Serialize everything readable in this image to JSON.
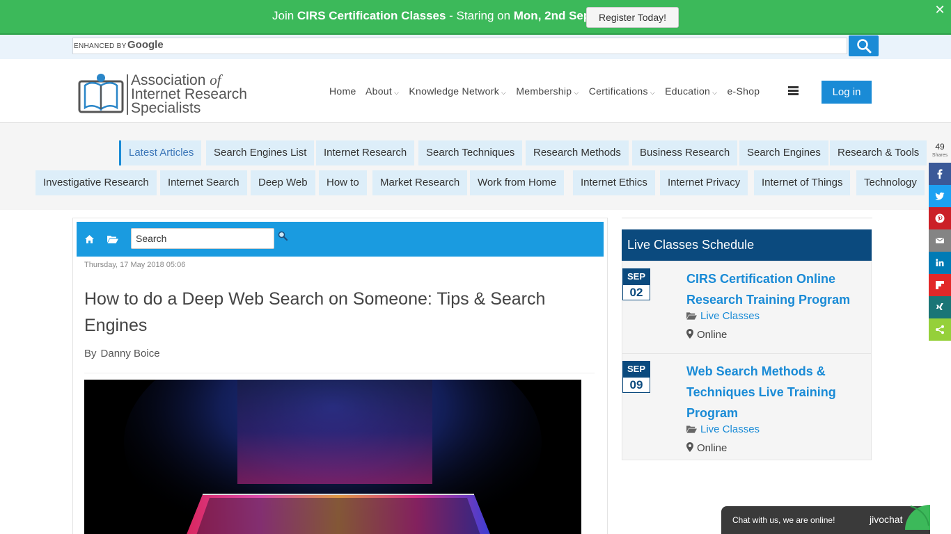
{
  "promo": {
    "prefix": "Join ",
    "highlight1": "CIRS Certification Classes",
    "middle": " - Staring on ",
    "highlight2": "Mon, 2nd Sept",
    "button": "Register Today!",
    "close": "✕"
  },
  "gsearch": {
    "enhanced_by": "ENHANCED BY",
    "brand": "Google"
  },
  "logo": {
    "line1_a": "Association ",
    "line1_b": "of",
    "line2": "Internet Research",
    "line3": "Specialists"
  },
  "nav": {
    "items": [
      "Home",
      "About",
      "Knowledge Network",
      "Membership",
      "Certifications",
      "Education",
      "e-Shop"
    ],
    "login": "Log in"
  },
  "tags": {
    "row1": [
      "Latest Articles",
      "Search Engines List",
      "Internet Research",
      "Search Techniques",
      "Research Methods",
      "Business Research",
      "Search Engines",
      "Research & Tools"
    ],
    "row2": [
      "Investigative Research",
      "Internet Search",
      "Deep Web",
      "How to",
      "Market Research",
      "Work from Home",
      "Internet Ethics",
      "Internet Privacy",
      "Internet of Things",
      "Technology"
    ]
  },
  "share": {
    "count": "49",
    "label": "Shares"
  },
  "article": {
    "search_placeholder": "Search",
    "date": "Thursday, 17 May 2018 05:06",
    "title": "How to do a Deep Web Search on Someone: Tips & Search Engines",
    "by": "By",
    "author": "Danny Boice"
  },
  "sidebar": {
    "header": "Live Classes Schedule",
    "events": [
      {
        "month": "SEP",
        "day": "02",
        "title": "CIRS Certification Online Research Training Program",
        "category": "Live Classes",
        "location": "Online"
      },
      {
        "month": "SEP",
        "day": "09",
        "title": "Web Search Methods & Techniques Live Training Program",
        "category": "Live Classes",
        "location": "Online"
      }
    ]
  },
  "chat": {
    "text": "Chat with us, we are online!",
    "brand": "jivochat"
  },
  "colors": {
    "promo_green": "#3cb95a",
    "brand_blue": "#1a8bd6",
    "navy": "#0b4a7e",
    "tag_bg": "#ddeef9",
    "facebook": "#3b5998",
    "twitter": "#1da1f2",
    "pinterest": "#cb2027",
    "email": "#848484",
    "linkedin": "#007bb5",
    "flipboard": "#e12828",
    "xing": "#1a7576",
    "sharethis": "#95d03a"
  }
}
